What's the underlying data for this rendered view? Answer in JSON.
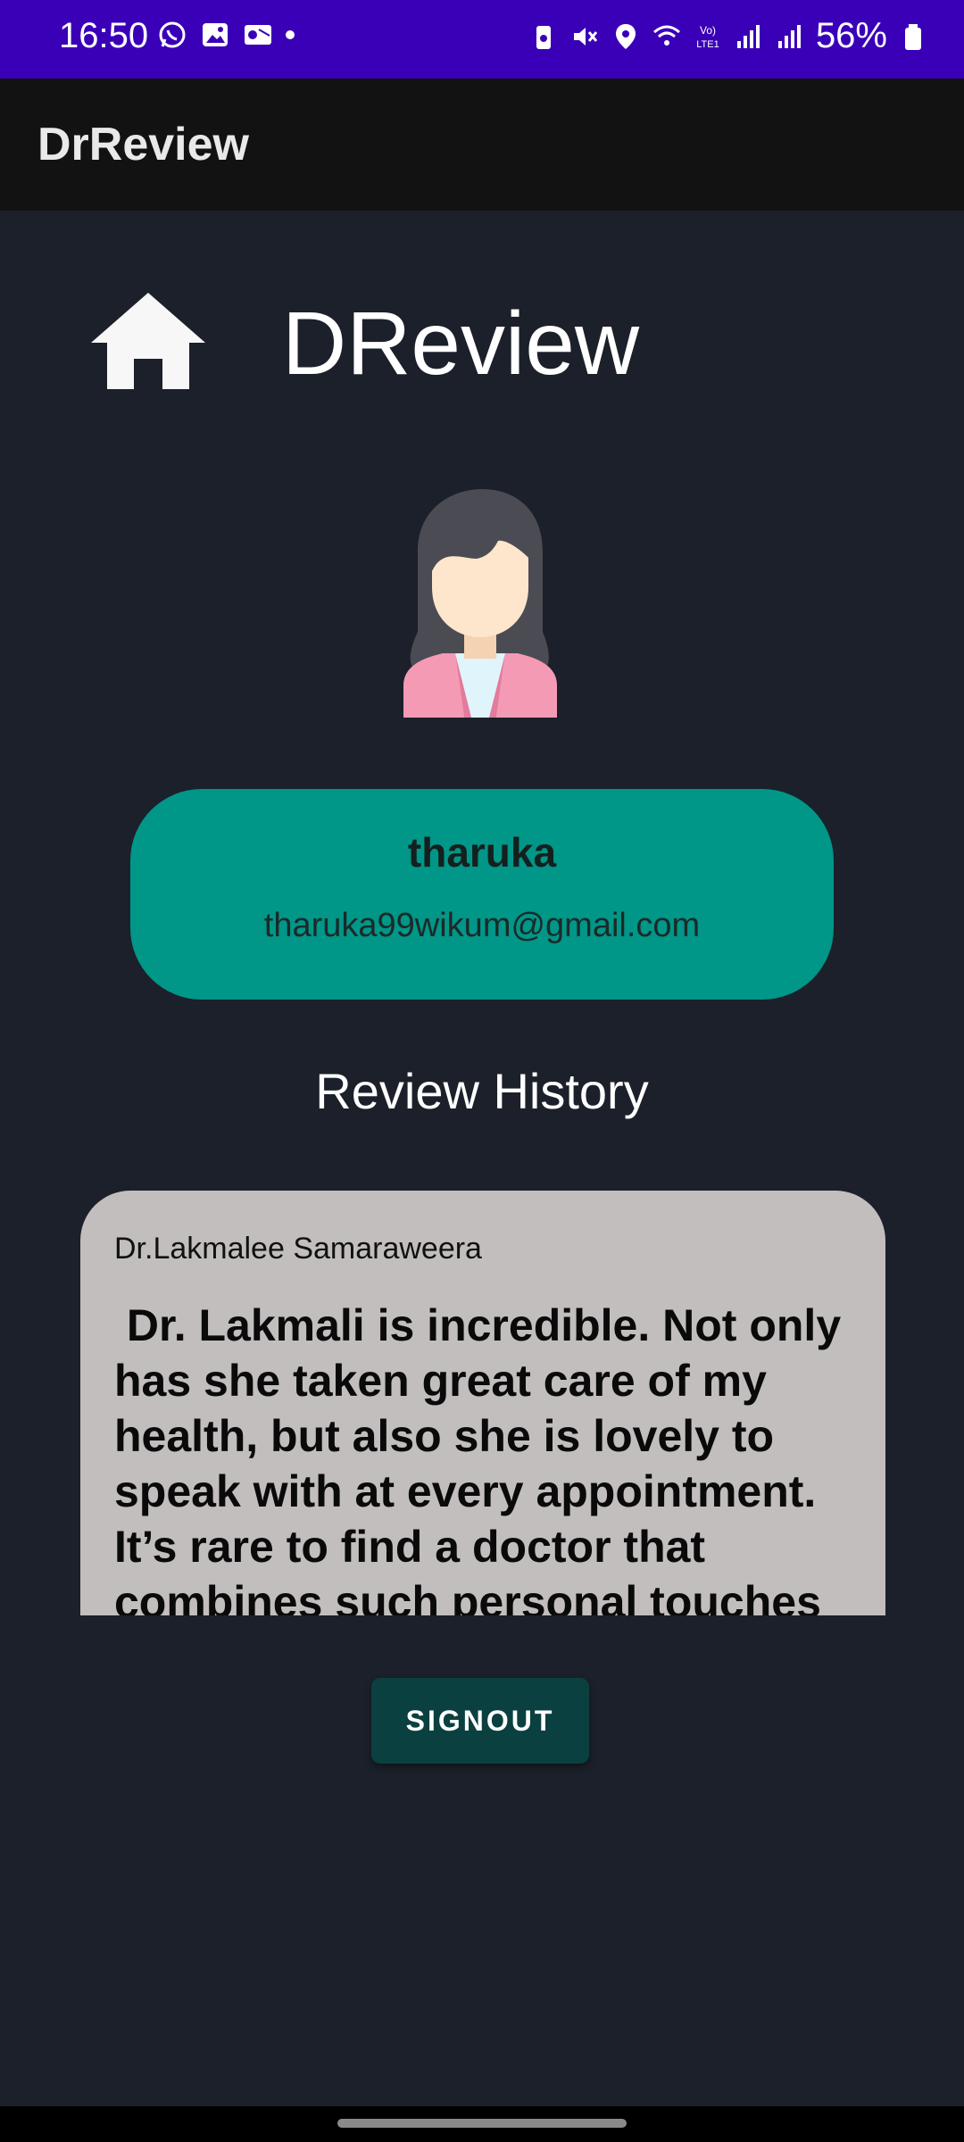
{
  "status_bar": {
    "time": "16:50",
    "battery": "56%",
    "left_icons": [
      "whatsapp-icon",
      "gallery-icon",
      "outlook-icon",
      "dot"
    ],
    "right_icons": [
      "battery-saver-icon",
      "mute-icon",
      "location-icon",
      "wifi-icon",
      "volte-icon",
      "signal-icon",
      "signal-icon",
      "battery-icon"
    ],
    "color": "#3a00b8"
  },
  "app_bar": {
    "title": "DrReview"
  },
  "header": {
    "brand": "DReview",
    "icon": "home-icon"
  },
  "profile": {
    "avatar": "female-avatar-icon",
    "name": "tharuka",
    "email": "tharuka99wikum@gmail.com",
    "card_color": "#009688"
  },
  "reviews": {
    "heading": "Review History",
    "items": [
      {
        "doctor": "Dr.Lakmalee Samaraweera",
        "text": " Dr. Lakmali is incredible. Not only has she taken great care of my health, but also she is lovely to speak with at every appointment. It’s rare to find a doctor that combines such personal touches"
      }
    ]
  },
  "actions": {
    "signout": "SIGNOUT"
  }
}
